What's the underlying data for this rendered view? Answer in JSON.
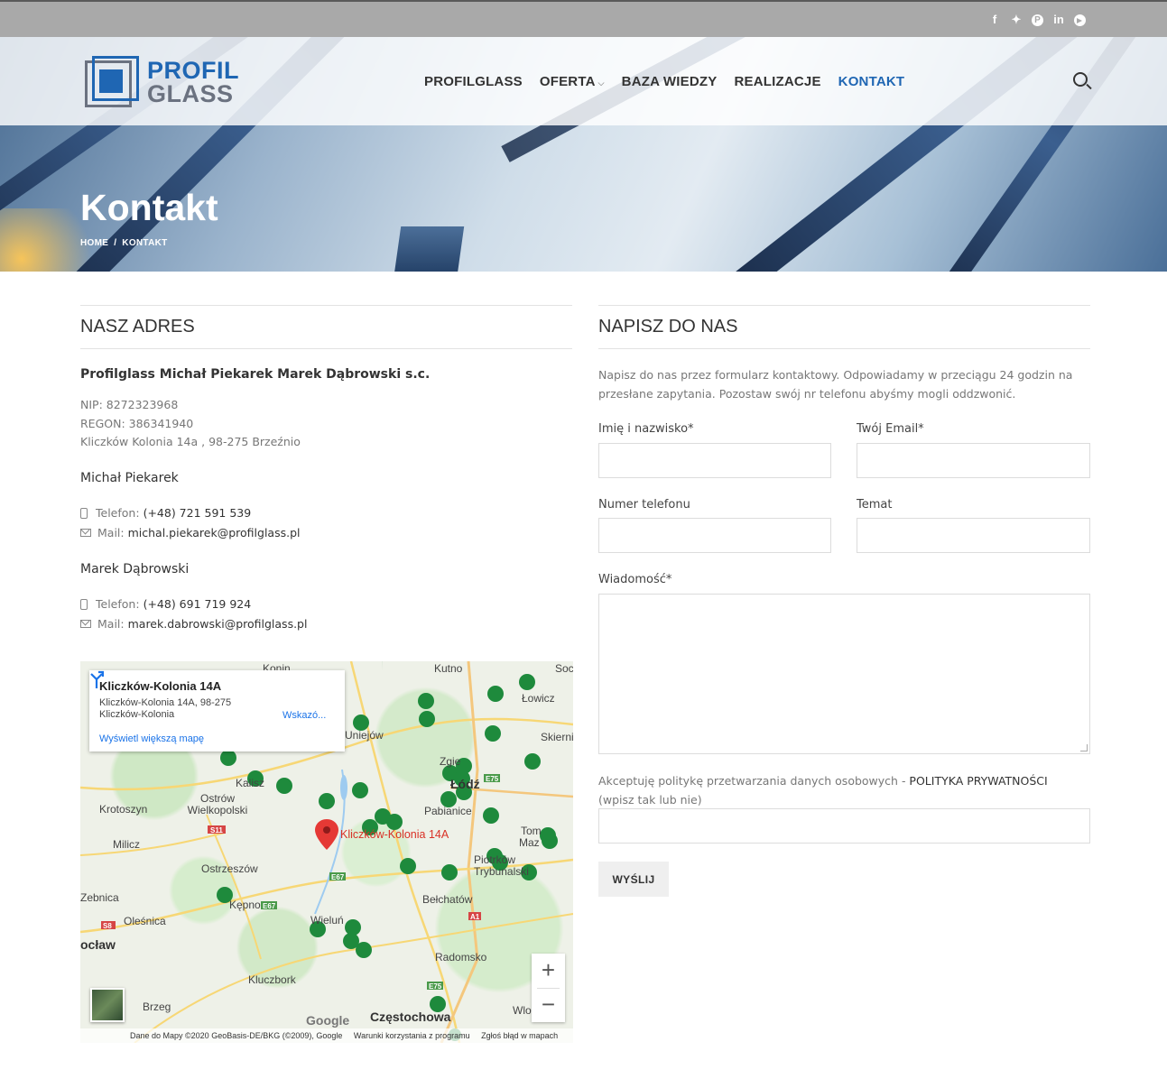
{
  "social": {
    "facebook": "f",
    "twitter": "t",
    "pinterest": "p",
    "linkedin": "in",
    "telegram": "tg"
  },
  "logo": {
    "line1": "PROFIL",
    "line2": "GLASS"
  },
  "nav": [
    {
      "label": "PROFILGLASS"
    },
    {
      "label": "OFERTA"
    },
    {
      "label": "BAZA WIEDZY"
    },
    {
      "label": "REALIZACJE"
    },
    {
      "label": "KONTAKT"
    }
  ],
  "hero": {
    "title": "Kontakt",
    "breadcrumb_home": "HOME",
    "breadcrumb_sep": "/",
    "breadcrumb_current": "KONTAKT"
  },
  "address": {
    "section_title": "NASZ ADRES",
    "company": "Profilglass Michał Piekarek Marek Dąbrowski s.c.",
    "nip": "NIP: 8272323968",
    "regon": "REGON: 386341940",
    "street": "Kliczków Kolonia 14a , 98-275 Brzeźnio",
    "person1": {
      "name": "Michał Piekarek",
      "phone_label": "Telefon:",
      "phone": "(+48) 721 591 539",
      "mail_label": "Mail:",
      "mail": "michal.piekarek@profilglass.pl"
    },
    "person2": {
      "name": "Marek Dąbrowski",
      "phone_label": "Telefon:",
      "phone": "(+48) 691 719 924",
      "mail_label": "Mail:",
      "mail": "marek.dabrowski@profilglass.pl"
    }
  },
  "map": {
    "info_title": "Kliczków-Kolonia 14A",
    "info_address": "Kliczków-Kolonia 14A, 98-275 Kliczków-Kolonia",
    "info_link": "Wyświetl większą mapę",
    "info_directions": "Wskazó...",
    "marker_label": "Kliczków-Kolonia 14A",
    "places": [
      "Konin",
      "Kutno",
      "Soc",
      "Łowicz",
      "Uniejów",
      "Skierni",
      "Zgie",
      "Łódź",
      "Kalisz",
      "Ostrów Wielkopolski",
      "Krotoszyn",
      "Pabianice",
      "Tom",
      "Maz",
      "Milicz",
      "Ostrzeszów",
      "Piotrków Trybunalski",
      "Zebnica",
      "Kępno",
      "Oleśnica",
      "Wieluń",
      "Bełchatów",
      "ocław",
      "Radomsko",
      "Kluczbork",
      "Brzeg",
      "Częstochowa",
      "Wlo"
    ],
    "roads": [
      "E75",
      "S11",
      "E67",
      "E67",
      "S8",
      "A1",
      "E75"
    ],
    "zoom_in": "+",
    "zoom_out": "−",
    "google": "Google",
    "attrib_data": "Dane do Mapy ©2020 GeoBasis-DE/BKG (©2009), Google",
    "attrib_terms": "Warunki korzystania z programu",
    "attrib_report": "Zgłoś błąd w mapach"
  },
  "form": {
    "section_title": "NAPISZ DO NAS",
    "intro": "Napisz do nas przez formularz kontaktowy. Odpowiadamy w przeciągu 24 godzin na przesłane zapytania. Pozostaw swój nr telefonu abyśmy mogli oddzwonić.",
    "name_label": "Imię i nazwisko*",
    "email_label": "Twój Email*",
    "phone_label": "Numer telefonu",
    "subject_label": "Temat",
    "message_label": "Wiadomość*",
    "consent_text": "Akceptuję politykę przetwarzania danych osobowych - ",
    "consent_link": "POLITYKA PRYWATNOŚCI",
    "consent_hint": "(wpisz tak lub nie)",
    "submit_label": "WYŚLIJ"
  }
}
